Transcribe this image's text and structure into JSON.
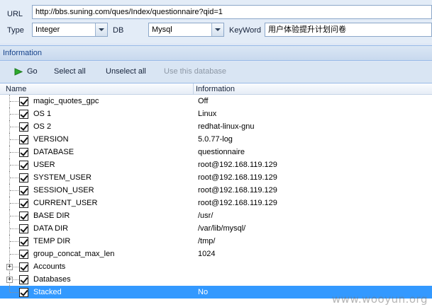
{
  "form": {
    "url_label": "URL",
    "url_value": "http://bbs.suning.com/ques/Index/questionnaire?qid=1",
    "type_label": "Type",
    "type_value": "Integer",
    "db_label": "DB",
    "db_value": "Mysql",
    "keyword_label": "KeyWord",
    "keyword_value": "用户体验提升计划问卷"
  },
  "panel": {
    "title": "Information"
  },
  "toolbar": {
    "go_label": "Go",
    "select_all_label": "Select all",
    "unselect_all_label": "Unselect all",
    "use_db_label": "Use this database"
  },
  "grid": {
    "col_name": "Name",
    "col_info": "Information",
    "rows": [
      {
        "name": "magic_quotes_gpc",
        "info": "Off"
      },
      {
        "name": "OS 1",
        "info": "Linux"
      },
      {
        "name": "OS 2",
        "info": "redhat-linux-gnu"
      },
      {
        "name": "VERSION",
        "info": "5.0.77-log"
      },
      {
        "name": "DATABASE",
        "info": "questionnaire"
      },
      {
        "name": "USER",
        "info": "root@192.168.119.129"
      },
      {
        "name": "SYSTEM_USER",
        "info": "root@192.168.119.129"
      },
      {
        "name": "SESSION_USER",
        "info": "root@192.168.119.129"
      },
      {
        "name": "CURRENT_USER",
        "info": "root@192.168.119.129"
      },
      {
        "name": "BASE DIR",
        "info": "/usr/"
      },
      {
        "name": "DATA DIR",
        "info": "/var/lib/mysql/"
      },
      {
        "name": "TEMP DIR",
        "info": "/tmp/"
      },
      {
        "name": "group_concat_max_len",
        "info": "1024"
      },
      {
        "name": "Accounts",
        "info": ""
      },
      {
        "name": "Databases",
        "info": ""
      },
      {
        "name": "Stacked",
        "info": "No"
      }
    ]
  },
  "watermark": "www.wooyun.org",
  "colors": {
    "selected_row": "#3399ff",
    "panel_title": "#15428b",
    "go_icon": "#2eaa2e"
  },
  "icons": {
    "go": "play-arrow-icon",
    "combo": "chevron-down-icon",
    "checkbox": "checkbox-checked-icon",
    "expander": "plus-box-icon"
  }
}
